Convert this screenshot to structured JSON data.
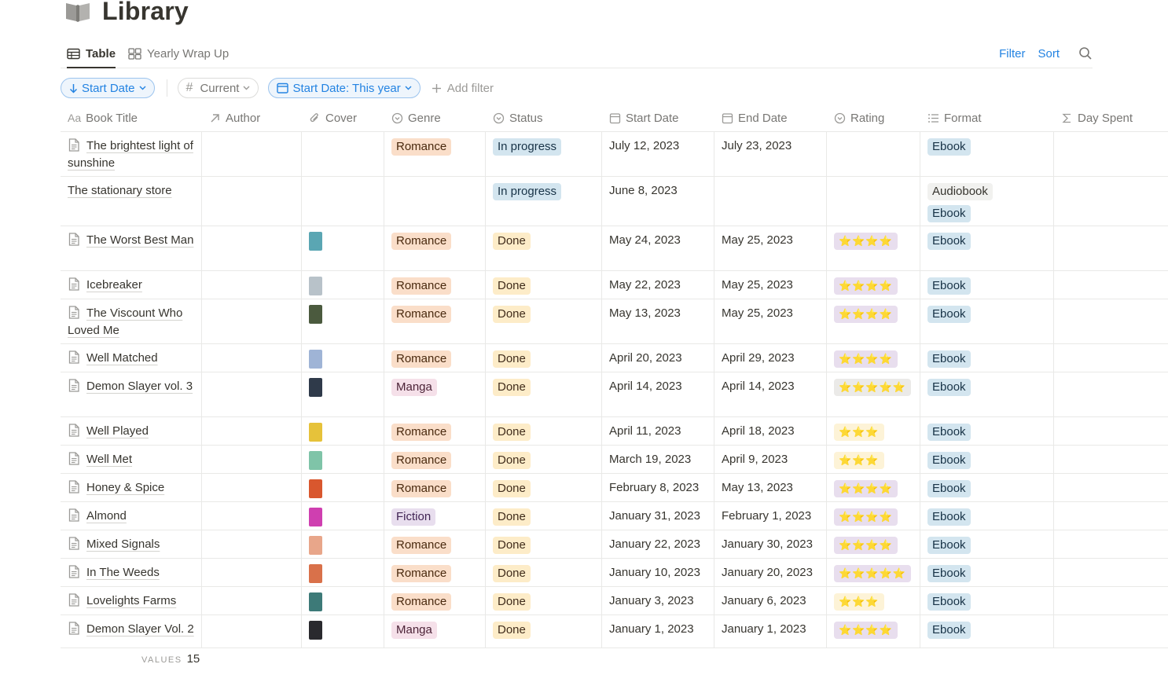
{
  "page": {
    "title": "Library",
    "icon": "book-icon"
  },
  "tabs": [
    {
      "label": "Table",
      "icon": "table-icon",
      "active": true
    },
    {
      "label": "Yearly Wrap Up",
      "icon": "gallery-icon",
      "active": false
    }
  ],
  "toolbar": {
    "filter_label": "Filter",
    "sort_label": "Sort",
    "search_icon": "search-icon"
  },
  "filters": {
    "sort_chip": "Start Date",
    "current_chip": "Current",
    "date_chip": "Start Date: This year",
    "add_filter": "Add filter"
  },
  "columns": [
    {
      "key": "title",
      "label": "Book Title",
      "icon": "text-icon"
    },
    {
      "key": "author",
      "label": "Author",
      "icon": "relation-arrow-icon"
    },
    {
      "key": "cover",
      "label": "Cover",
      "icon": "paperclip-icon"
    },
    {
      "key": "genre",
      "label": "Genre",
      "icon": "select-icon"
    },
    {
      "key": "status",
      "label": "Status",
      "icon": "select-icon"
    },
    {
      "key": "start",
      "label": "Start Date",
      "icon": "calendar-icon"
    },
    {
      "key": "end",
      "label": "End Date",
      "icon": "calendar-icon"
    },
    {
      "key": "rating",
      "label": "Rating",
      "icon": "select-icon"
    },
    {
      "key": "format",
      "label": "Format",
      "icon": "list-icon"
    },
    {
      "key": "days",
      "label": "Day Spent",
      "icon": "sigma-icon"
    }
  ],
  "rows": [
    {
      "title": "The brightest light of sunshine",
      "doc": true,
      "cover": "",
      "genre": "Romance",
      "status": "In progress",
      "start": "July 12, 2023",
      "end": "July 23, 2023",
      "rating": "",
      "format": [
        "Ebook"
      ],
      "h": 57
    },
    {
      "title": "The stationary store",
      "doc": false,
      "cover": "",
      "genre": "",
      "status": "In progress",
      "start": "June 8, 2023",
      "end": "",
      "rating": "",
      "format": [
        "Audiobook",
        "Ebook"
      ],
      "h": 63
    },
    {
      "title": "The Worst Best Man",
      "doc": true,
      "cover": "#5aa6b3",
      "genre": "Romance",
      "status": "Done",
      "start": "May 24, 2023",
      "end": "May 25, 2023",
      "rating": "⭐⭐⭐⭐",
      "rating_style": "purple",
      "format": [
        "Ebook"
      ],
      "h": 57
    },
    {
      "title": "Icebreaker",
      "doc": true,
      "cover": "#b8c2c9",
      "genre": "Romance",
      "status": "Done",
      "start": "May 22, 2023",
      "end": "May 25, 2023",
      "rating": "⭐⭐⭐⭐",
      "rating_style": "purple",
      "format": [
        "Ebook"
      ],
      "h": 36
    },
    {
      "title": "The Viscount Who Loved Me",
      "doc": true,
      "cover": "#4b5a3e",
      "genre": "Romance",
      "status": "Done",
      "start": "May 13, 2023",
      "end": "May 25, 2023",
      "rating": "⭐⭐⭐⭐",
      "rating_style": "purple",
      "format": [
        "Ebook"
      ],
      "h": 57
    },
    {
      "title": "Well Matched",
      "doc": true,
      "cover": "#9fb4d6",
      "genre": "Romance",
      "status": "Done",
      "start": "April 20, 2023",
      "end": "April 29, 2023",
      "rating": "⭐⭐⭐⭐",
      "rating_style": "purple",
      "format": [
        "Ebook"
      ],
      "h": 36
    },
    {
      "title": "Demon Slayer vol. 3",
      "doc": true,
      "cover": "#2f3a4a",
      "genre": "Manga",
      "status": "Done",
      "start": "April 14, 2023",
      "end": "April 14, 2023",
      "rating": "⭐⭐⭐⭐⭐",
      "rating_style": "grey",
      "format": [
        "Ebook"
      ],
      "h": 57
    },
    {
      "title": "Well Played",
      "doc": true,
      "cover": "#e6c23a",
      "genre": "Romance",
      "status": "Done",
      "start": "April 11, 2023",
      "end": "April 18, 2023",
      "rating": "⭐⭐⭐",
      "rating_style": "yellow",
      "format": [
        "Ebook"
      ],
      "h": 36
    },
    {
      "title": "Well Met",
      "doc": true,
      "cover": "#7fc4a8",
      "genre": "Romance",
      "status": "Done",
      "start": "March 19, 2023",
      "end": "April 9, 2023",
      "rating": "⭐⭐⭐",
      "rating_style": "yellow",
      "format": [
        "Ebook"
      ],
      "h": 36
    },
    {
      "title": "Honey & Spice",
      "doc": true,
      "cover": "#d9572e",
      "genre": "Romance",
      "status": "Done",
      "start": "February 8, 2023",
      "end": "May 13, 2023",
      "rating": "⭐⭐⭐⭐",
      "rating_style": "purple",
      "format": [
        "Ebook"
      ],
      "h": 36
    },
    {
      "title": "Almond",
      "doc": true,
      "cover": "#cf3fb0",
      "genre": "Fiction",
      "status": "Done",
      "start": "January 31, 2023",
      "end": "February 1, 2023",
      "rating": "⭐⭐⭐⭐",
      "rating_style": "purple",
      "format": [
        "Ebook"
      ],
      "h": 36
    },
    {
      "title": "Mixed Signals",
      "doc": true,
      "cover": "#e8a68a",
      "genre": "Romance",
      "status": "Done",
      "start": "January 22, 2023",
      "end": "January 30, 2023",
      "rating": "⭐⭐⭐⭐",
      "rating_style": "purple",
      "format": [
        "Ebook"
      ],
      "h": 36
    },
    {
      "title": "In The Weeds",
      "doc": true,
      "cover": "#d9714a",
      "genre": "Romance",
      "status": "Done",
      "start": "January 10, 2023",
      "end": "January 20, 2023",
      "rating": "⭐⭐⭐⭐⭐",
      "rating_style": "purple",
      "format": [
        "Ebook"
      ],
      "h": 36
    },
    {
      "title": "Lovelights Farms",
      "doc": true,
      "cover": "#3d7a78",
      "genre": "Romance",
      "status": "Done",
      "start": "January 3, 2023",
      "end": "January 6, 2023",
      "rating": "⭐⭐⭐",
      "rating_style": "yellow",
      "format": [
        "Ebook"
      ],
      "h": 36
    },
    {
      "title": "Demon Slayer Vol. 2",
      "doc": true,
      "cover": "#2a2a2e",
      "genre": "Manga",
      "status": "Done",
      "start": "January 1, 2023",
      "end": "January 1, 2023",
      "rating": "⭐⭐⭐⭐",
      "rating_style": "purple",
      "format": [
        "Ebook"
      ],
      "h": 42
    }
  ],
  "footer": {
    "label": "VALUES",
    "value": "15"
  }
}
